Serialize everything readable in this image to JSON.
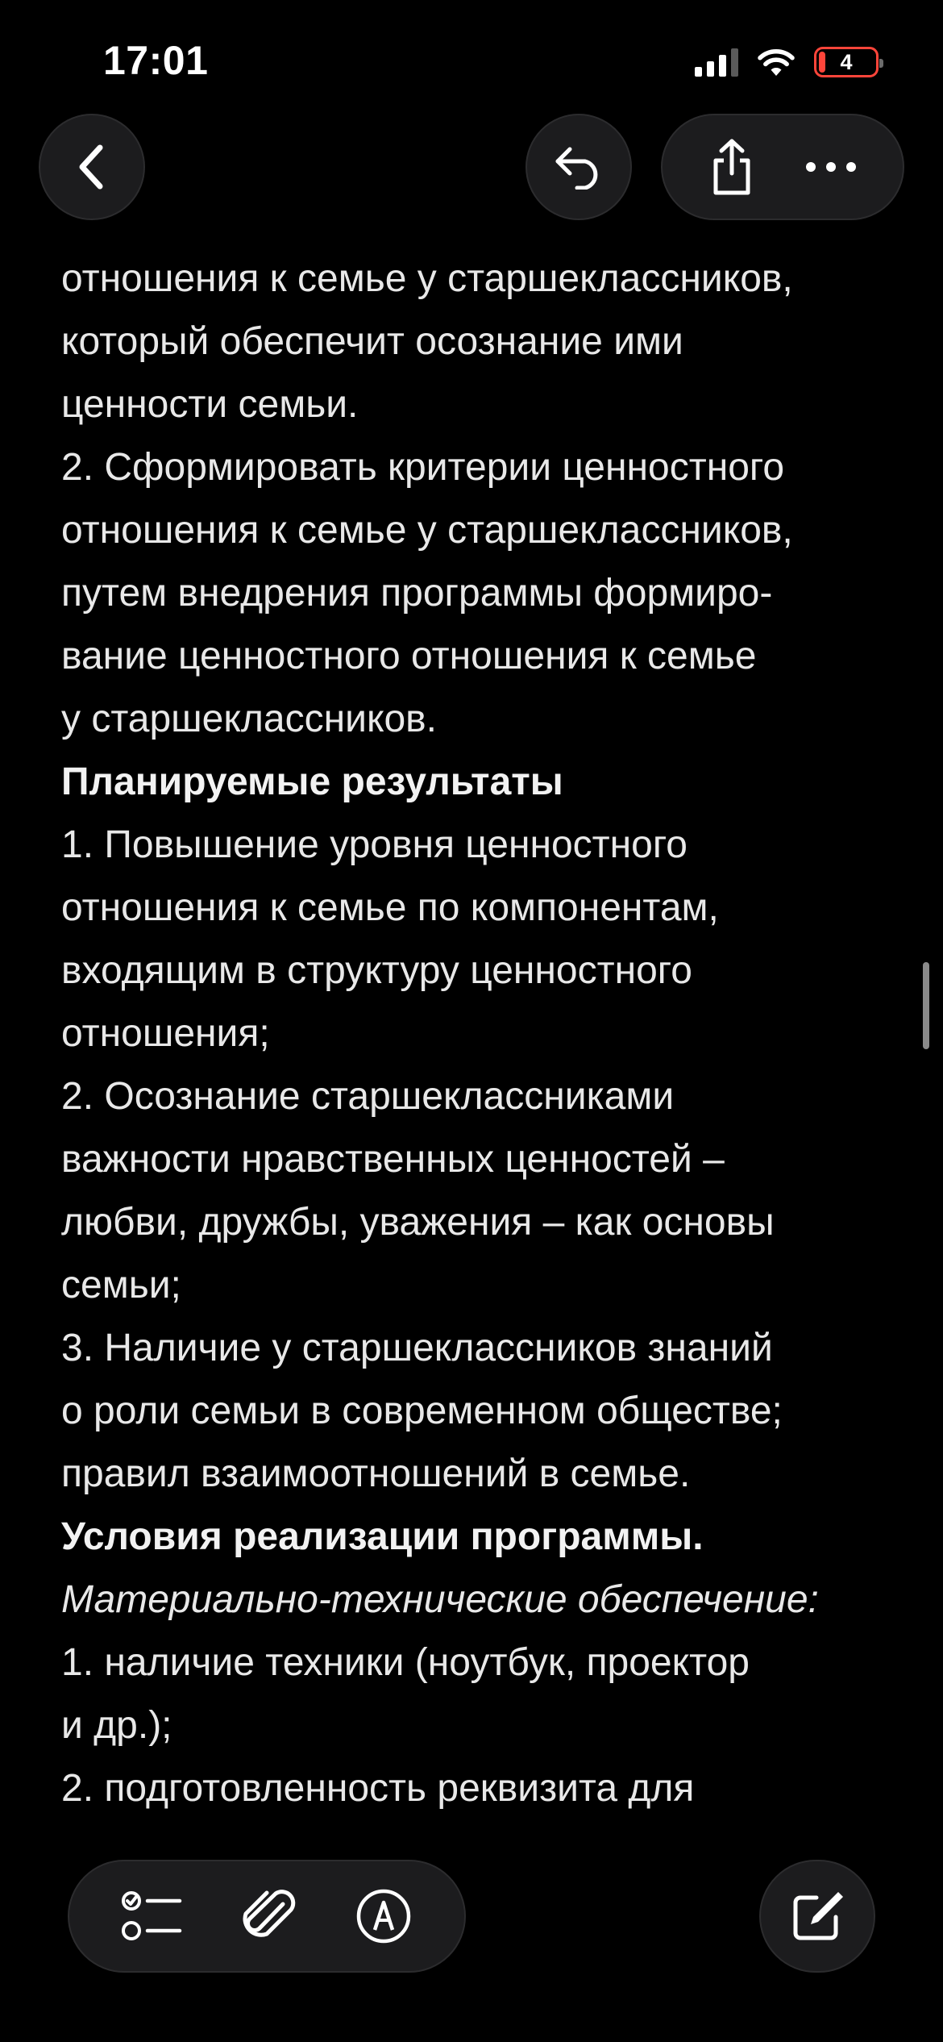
{
  "status_bar": {
    "time": "17:01",
    "battery_level": "4",
    "signal_bars_active": 3,
    "signal_bars_total": 4,
    "battery_fraction": 0.12,
    "battery_color": "#ff453a"
  },
  "nav": {
    "icons": [
      "chevron-left-icon",
      "undo-icon",
      "share-icon",
      "ellipsis-icon"
    ]
  },
  "note": {
    "lines": [
      {
        "text": "отношения к семье у старшеклассников,",
        "style": "normal"
      },
      {
        "text": "который обеспечит осознание ими",
        "style": "normal"
      },
      {
        "text": "ценности семьи.",
        "style": "normal"
      },
      {
        "text": "2. Сформировать критерии ценностного",
        "style": "normal"
      },
      {
        "text": "отношения к семье у старшеклассников,",
        "style": "normal"
      },
      {
        "text": "путем внедрения программы формиро-",
        "style": "normal"
      },
      {
        "text": "вание ценностного отношения к семье",
        "style": "normal"
      },
      {
        "text": "у старшеклассников.",
        "style": "normal"
      },
      {
        "text": "Планируемые результаты",
        "style": "heading"
      },
      {
        "text": "1. Повышение уровня ценностного",
        "style": "normal"
      },
      {
        "text": "отношения к семье по компонентам,",
        "style": "normal"
      },
      {
        "text": "входящим в структуру ценностного",
        "style": "normal"
      },
      {
        "text": "отношения;",
        "style": "normal"
      },
      {
        "text": "2. Осознание старшеклассниками",
        "style": "normal"
      },
      {
        "text": "важности нравственных ценностей –",
        "style": "normal"
      },
      {
        "text": "любви, дружбы, уважения – как основы",
        "style": "normal"
      },
      {
        "text": "семьи;",
        "style": "normal"
      },
      {
        "text": "3. Наличие у старшеклассников знаний",
        "style": "normal"
      },
      {
        "text": "о роли семьи в современном обществе;",
        "style": "normal"
      },
      {
        "text": "правил взаимоотношений в семье.",
        "style": "normal"
      },
      {
        "text": "Условия реализации программы.",
        "style": "heading"
      },
      {
        "text": "Материально-технические обеспечение:",
        "style": "italic"
      },
      {
        "text": "1. наличие техники (ноутбук, проектор",
        "style": "normal"
      },
      {
        "text": "и др.);",
        "style": "normal"
      },
      {
        "text": "2. подготовленность реквизита для",
        "style": "normal"
      }
    ]
  },
  "toolbar": {
    "icons": [
      "checklist-icon",
      "paperclip-icon",
      "markup-icon",
      "compose-icon"
    ]
  },
  "colors": {
    "background": "#000000",
    "button_fill": "#1c1c1e",
    "text": "#e8e8e8",
    "battery_low": "#ff453a"
  }
}
